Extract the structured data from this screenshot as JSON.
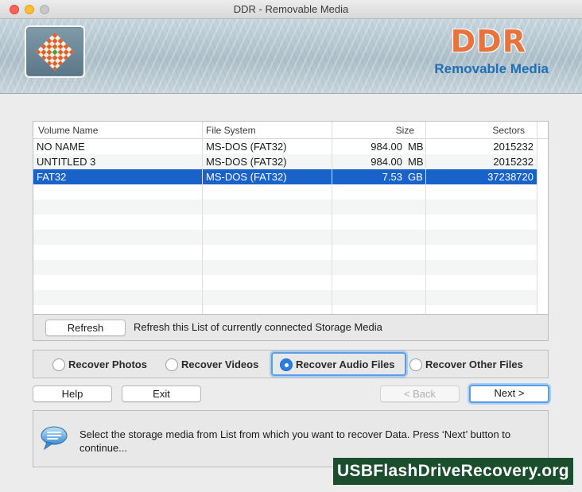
{
  "window": {
    "title": "DDR - Removable Media"
  },
  "banner": {
    "brand": "DDR",
    "subtitle": "Removable Media"
  },
  "table": {
    "columns": [
      "Volume Name",
      "File System",
      "Size",
      "Sectors"
    ],
    "rows": [
      {
        "name": "NO NAME",
        "fs": "MS-DOS (FAT32)",
        "size": "984.00",
        "unit": "MB",
        "sectors": "2015232"
      },
      {
        "name": "UNTITLED 3",
        "fs": "MS-DOS (FAT32)",
        "size": "984.00",
        "unit": "MB",
        "sectors": "2015232"
      },
      {
        "name": "FAT32",
        "fs": "MS-DOS (FAT32)",
        "size": "7.53",
        "unit": "GB",
        "sectors": "37238720"
      }
    ],
    "selected_index": 2
  },
  "refresh": {
    "button": "Refresh",
    "description": "Refresh this List of currently connected Storage Media"
  },
  "options": {
    "photos": "Recover Photos",
    "videos": "Recover Videos",
    "audio": "Recover Audio Files",
    "other": "Recover Other Files",
    "selected": "audio"
  },
  "buttons": {
    "help": "Help",
    "exit": "Exit",
    "back": "< Back",
    "next": "Next >"
  },
  "info": {
    "message": "Select the storage media from List from which you want to recover Data. Press ‘Next’ button to continue..."
  },
  "watermark": "USBFlashDriveRecovery.org",
  "colors": {
    "accent": "#1862c9",
    "brand": "#e8743b",
    "subtitle": "#1f6fb3",
    "watermark_bg": "#1a4e2c"
  }
}
